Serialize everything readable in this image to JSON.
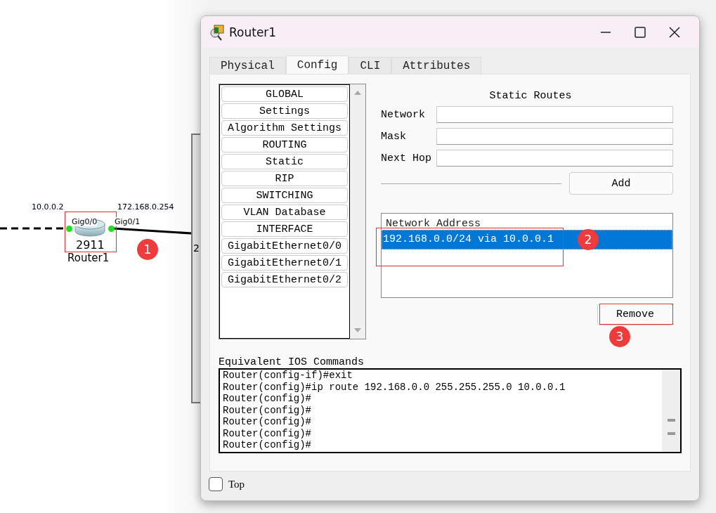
{
  "topology": {
    "device": {
      "model": "2911",
      "name": "Router1"
    },
    "ports": [
      {
        "name": "Gig0/0",
        "ip": "10.0.0.2",
        "on": true
      },
      {
        "name": "Gig0/1",
        "ip": "172.168.0.254",
        "on": true
      }
    ],
    "hidden_label": "2"
  },
  "annotations": [
    {
      "number": "1"
    },
    {
      "number": "2"
    },
    {
      "number": "3"
    }
  ],
  "window": {
    "title": "Router1"
  },
  "tabs": [
    {
      "label": "Physical",
      "selected": false
    },
    {
      "label": "Config",
      "selected": true
    },
    {
      "label": "CLI",
      "selected": false
    },
    {
      "label": "Attributes",
      "selected": false
    }
  ],
  "sidebar": {
    "items": [
      {
        "label": "GLOBAL"
      },
      {
        "label": "Settings"
      },
      {
        "label": "Algorithm Settings"
      },
      {
        "label": "ROUTING"
      },
      {
        "label": "Static"
      },
      {
        "label": "RIP"
      },
      {
        "label": "SWITCHING"
      },
      {
        "label": "VLAN Database"
      },
      {
        "label": "INTERFACE"
      },
      {
        "label": "GigabitEthernet0/0"
      },
      {
        "label": "GigabitEthernet0/1"
      },
      {
        "label": "GigabitEthernet0/2"
      }
    ]
  },
  "static_routes": {
    "title": "Static Routes",
    "fields": [
      {
        "label": "Network"
      },
      {
        "label": "Mask"
      },
      {
        "label": "Next Hop"
      }
    ],
    "add_button": "Add",
    "list": {
      "header": "Network Address",
      "rows": [
        {
          "text": "192.168.0.0/24 via 10.0.0.1",
          "selected": true
        }
      ]
    },
    "remove_button": "Remove"
  },
  "commands": {
    "label": "Equivalent IOS Commands",
    "lines": [
      "Router(config-if)#exit",
      "Router(config)#ip route 192.168.0.0 255.255.255.0 10.0.0.1",
      "Router(config)#",
      "Router(config)#",
      "Router(config)#",
      "Router(config)#",
      "Router(config)#"
    ]
  },
  "top_checkbox": {
    "label": "Top",
    "checked": false
  }
}
